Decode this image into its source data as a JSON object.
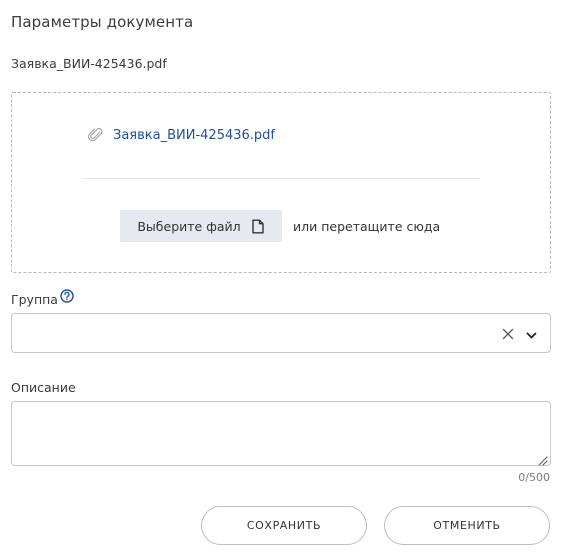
{
  "dialog": {
    "title": "Параметры документа",
    "filename": "Заявка_ВИИ-425436.pdf"
  },
  "dropzone": {
    "attached_file": "Заявка_ВИИ-425436.pdf",
    "choose_button_label": "Выберите файл",
    "drag_hint": "или перетащите сюда",
    "icons": [
      "paperclip-icon",
      "file-icon"
    ]
  },
  "group": {
    "label": "Группа",
    "value": "",
    "icons": [
      "help-icon",
      "clear-icon",
      "chevron-down-icon"
    ]
  },
  "description": {
    "label": "Описание",
    "value": "",
    "counter": "0/500"
  },
  "actions": {
    "save_label": "СОХРАНИТЬ",
    "cancel_label": "ОТМЕНИТЬ"
  },
  "colors": {
    "link": "#1f4fa3",
    "choose_button_bg": "#e7e9f1",
    "border": "#c8c8c8"
  }
}
